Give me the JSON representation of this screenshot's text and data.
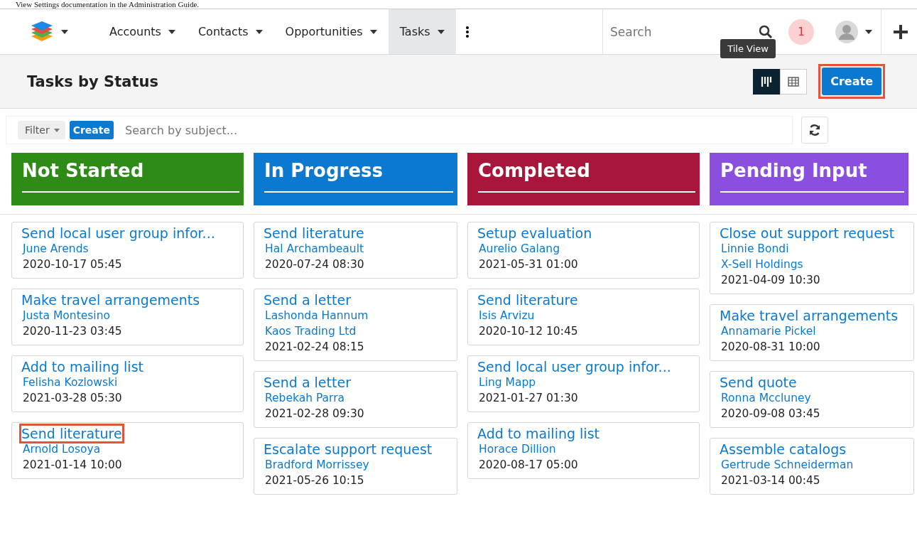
{
  "doc_text": "View Settings documentation in the Administration Guide.",
  "nav": {
    "items": [
      {
        "label": "Accounts",
        "selected": false
      },
      {
        "label": "Contacts",
        "selected": false
      },
      {
        "label": "Opportunities",
        "selected": false
      },
      {
        "label": "Tasks",
        "selected": true
      }
    ],
    "search": {
      "placeholder": "Search"
    },
    "notification_count": "1"
  },
  "tooltip": "Tile View",
  "header": {
    "title": "Tasks by Status",
    "views": [
      {
        "kind": "tile",
        "selected": true
      },
      {
        "kind": "list",
        "selected": false
      }
    ],
    "create": {
      "label": "Create",
      "highlighted": true
    }
  },
  "filter_bar": {
    "filter": "Filter",
    "create": "Create",
    "search": {
      "placeholder": "Search by subject..."
    }
  },
  "columns": [
    {
      "title": "Not Started",
      "color": "#2e8b17",
      "cards": [
        {
          "subject": "Send local user group infor...",
          "lines": [
            "June Arends"
          ],
          "date": "2020-10-17 05:45",
          "highlighted": false
        },
        {
          "subject": "Make travel arrangements",
          "lines": [
            "Justa Montesino"
          ],
          "date": "2020-11-23 03:45",
          "highlighted": false
        },
        {
          "subject": "Add to mailing list",
          "lines": [
            "Felisha Kozlowski"
          ],
          "date": "2021-03-28 05:30",
          "highlighted": false
        },
        {
          "subject": "Send literature",
          "lines": [
            "Arnold Losoya"
          ],
          "date": "2021-01-14 10:00",
          "highlighted": true
        }
      ]
    },
    {
      "title": "In Progress",
      "color": "#0b79d0",
      "cards": [
        {
          "subject": "Send literature",
          "lines": [
            "Hal Archambeault"
          ],
          "date": "2020-07-24 08:30",
          "highlighted": false
        },
        {
          "subject": "Send a letter",
          "lines": [
            "Lashonda Hannum",
            "Kaos Trading Ltd"
          ],
          "date": "2021-02-24 08:15",
          "highlighted": false
        },
        {
          "subject": "Send a letter",
          "lines": [
            "Rebekah Parra"
          ],
          "date": "2021-02-28 09:30",
          "highlighted": false
        },
        {
          "subject": "Escalate support request",
          "lines": [
            "Bradford Morrissey"
          ],
          "date": "2021-05-26 10:15",
          "highlighted": false
        }
      ]
    },
    {
      "title": "Completed",
      "color": "#a8173b",
      "cards": [
        {
          "subject": "Setup evaluation",
          "lines": [
            "Aurelio Galang"
          ],
          "date": "2021-05-31 01:00",
          "highlighted": false
        },
        {
          "subject": "Send literature",
          "lines": [
            "Isis Arvizu"
          ],
          "date": "2020-10-12 10:45",
          "highlighted": false
        },
        {
          "subject": "Send local user group infor...",
          "lines": [
            "Ling Mapp"
          ],
          "date": "2021-01-27 01:30",
          "highlighted": false
        },
        {
          "subject": "Add to mailing list",
          "lines": [
            "Horace Dillion"
          ],
          "date": "2020-08-17 05:00",
          "highlighted": false
        }
      ]
    },
    {
      "title": "Pending Input",
      "color": "#8a4fdf",
      "cards": [
        {
          "subject": "Close out support request",
          "lines": [
            "Linnie Bondi",
            "X-Sell Holdings"
          ],
          "date": "2021-04-09 10:30",
          "highlighted": false
        },
        {
          "subject": "Make travel arrangements",
          "lines": [
            "Annamarie Pickel"
          ],
          "date": "2020-08-31 10:00",
          "highlighted": false
        },
        {
          "subject": "Send quote",
          "lines": [
            "Ronna Mccluney"
          ],
          "date": "2020-09-08 03:45",
          "highlighted": false
        },
        {
          "subject": "Assemble catalogs",
          "lines": [
            "Gertrude Schneiderman"
          ],
          "date": "2021-03-14 00:45",
          "highlighted": false
        }
      ]
    }
  ]
}
